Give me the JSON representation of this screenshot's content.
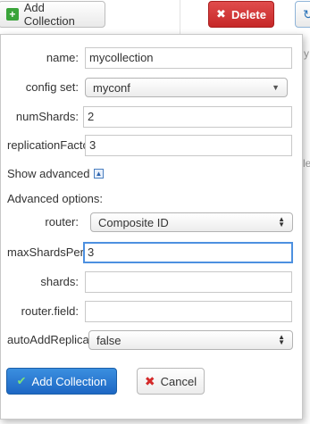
{
  "toolbar": {
    "add_collection_label": "Add Collection",
    "delete_label": "Delete"
  },
  "background": {
    "right_fragment_1": "y",
    "right_fragment_2": "le"
  },
  "form": {
    "name": {
      "label": "name:",
      "value": "mycollection"
    },
    "config_set": {
      "label": "config set:",
      "value": "myconf"
    },
    "num_shards": {
      "label": "numShards:",
      "value": "2"
    },
    "replication_factor": {
      "label": "replicationFactor:",
      "value": "3"
    },
    "show_advanced_label": "Show advanced",
    "advanced_options_label": "Advanced options:",
    "router": {
      "label": "router:",
      "value": "Composite ID"
    },
    "max_shards_per_node": {
      "label": "maxShardsPerNode:",
      "value": "3"
    },
    "shards": {
      "label": "shards:",
      "value": ""
    },
    "router_field": {
      "label": "router.field:",
      "value": ""
    },
    "auto_add_replicas": {
      "label": "autoAddReplicas:",
      "value": "false"
    },
    "submit_label": "Add Collection",
    "cancel_label": "Cancel"
  },
  "colors": {
    "primary_button": "#1d67c4",
    "delete_button": "#c62828",
    "focus_border": "#4d90e0"
  }
}
